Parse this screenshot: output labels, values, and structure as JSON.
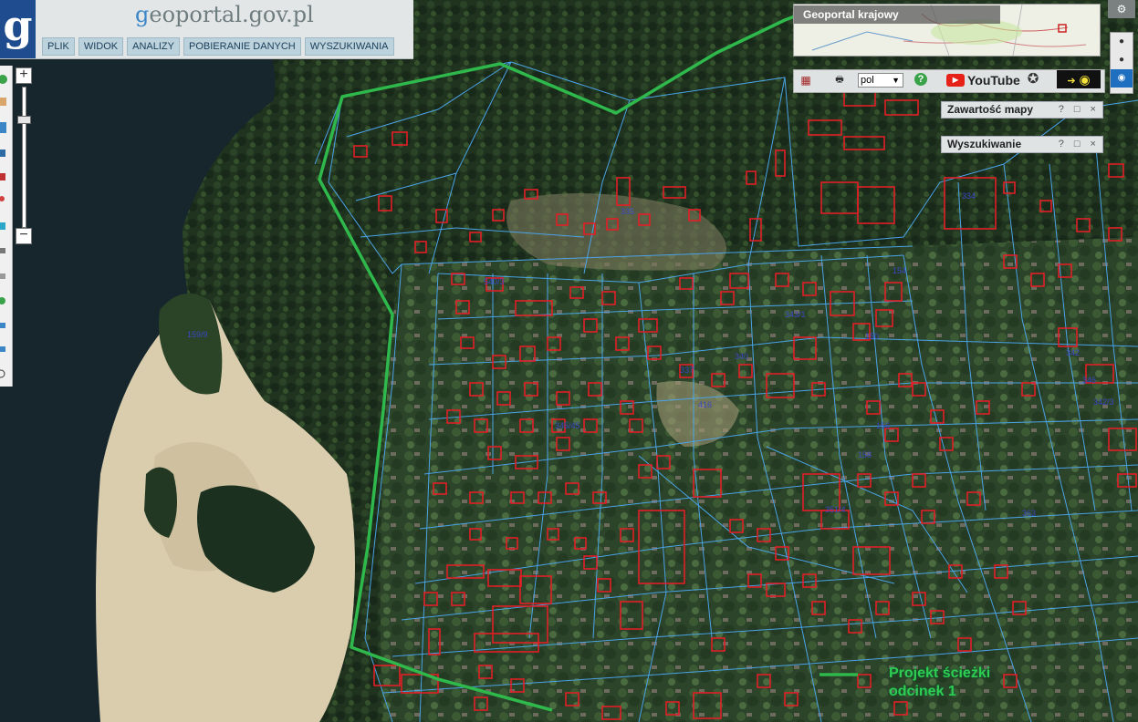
{
  "header": {
    "logo_letter": "g",
    "site_title_prefix": "g",
    "site_title_rest": "eoportal.gov.pl",
    "menu": [
      {
        "label": "PLIK"
      },
      {
        "label": "WIDOK"
      },
      {
        "label": "ANALIZY"
      },
      {
        "label": "POBIERANIE DANYCH"
      },
      {
        "label": "WYSZUKIWANIA"
      }
    ]
  },
  "zoom": {
    "in_label": "+",
    "out_label": "−",
    "level_fraction": 0.22
  },
  "overview": {
    "label": "Geoportal krajowy"
  },
  "toolbar": {
    "language": "pol",
    "youtube_label": "YouTube",
    "icons": [
      "grid-icon",
      "wms-icon",
      "help-icon",
      "youtube-icon",
      "film-reel-icon",
      "arrow-right-icon",
      "eye-icon"
    ]
  },
  "panels": [
    {
      "title": "Zawartość mapy",
      "buttons": "? □ ×"
    },
    {
      "title": "Wyszukiwanie",
      "buttons": "? □ ×"
    }
  ],
  "legend": {
    "line1": "Projekt ścieżki",
    "line2": "odcinek 1",
    "line_color": "#2fb84b"
  },
  "map_labels": [
    "159/9",
    "335",
    "416",
    "540/3",
    "342",
    "334",
    "343/1",
    "346",
    "337",
    "340",
    "345/45",
    "150",
    "158",
    "154",
    "156",
    "351/4",
    "363",
    "342/3"
  ],
  "colors": {
    "parcel_border": "#4aa3e8",
    "building_border": "#e21e26",
    "route": "#2fb84b",
    "water": "#18282e",
    "forest": "#1f3523",
    "sand": "#d8ccae"
  }
}
